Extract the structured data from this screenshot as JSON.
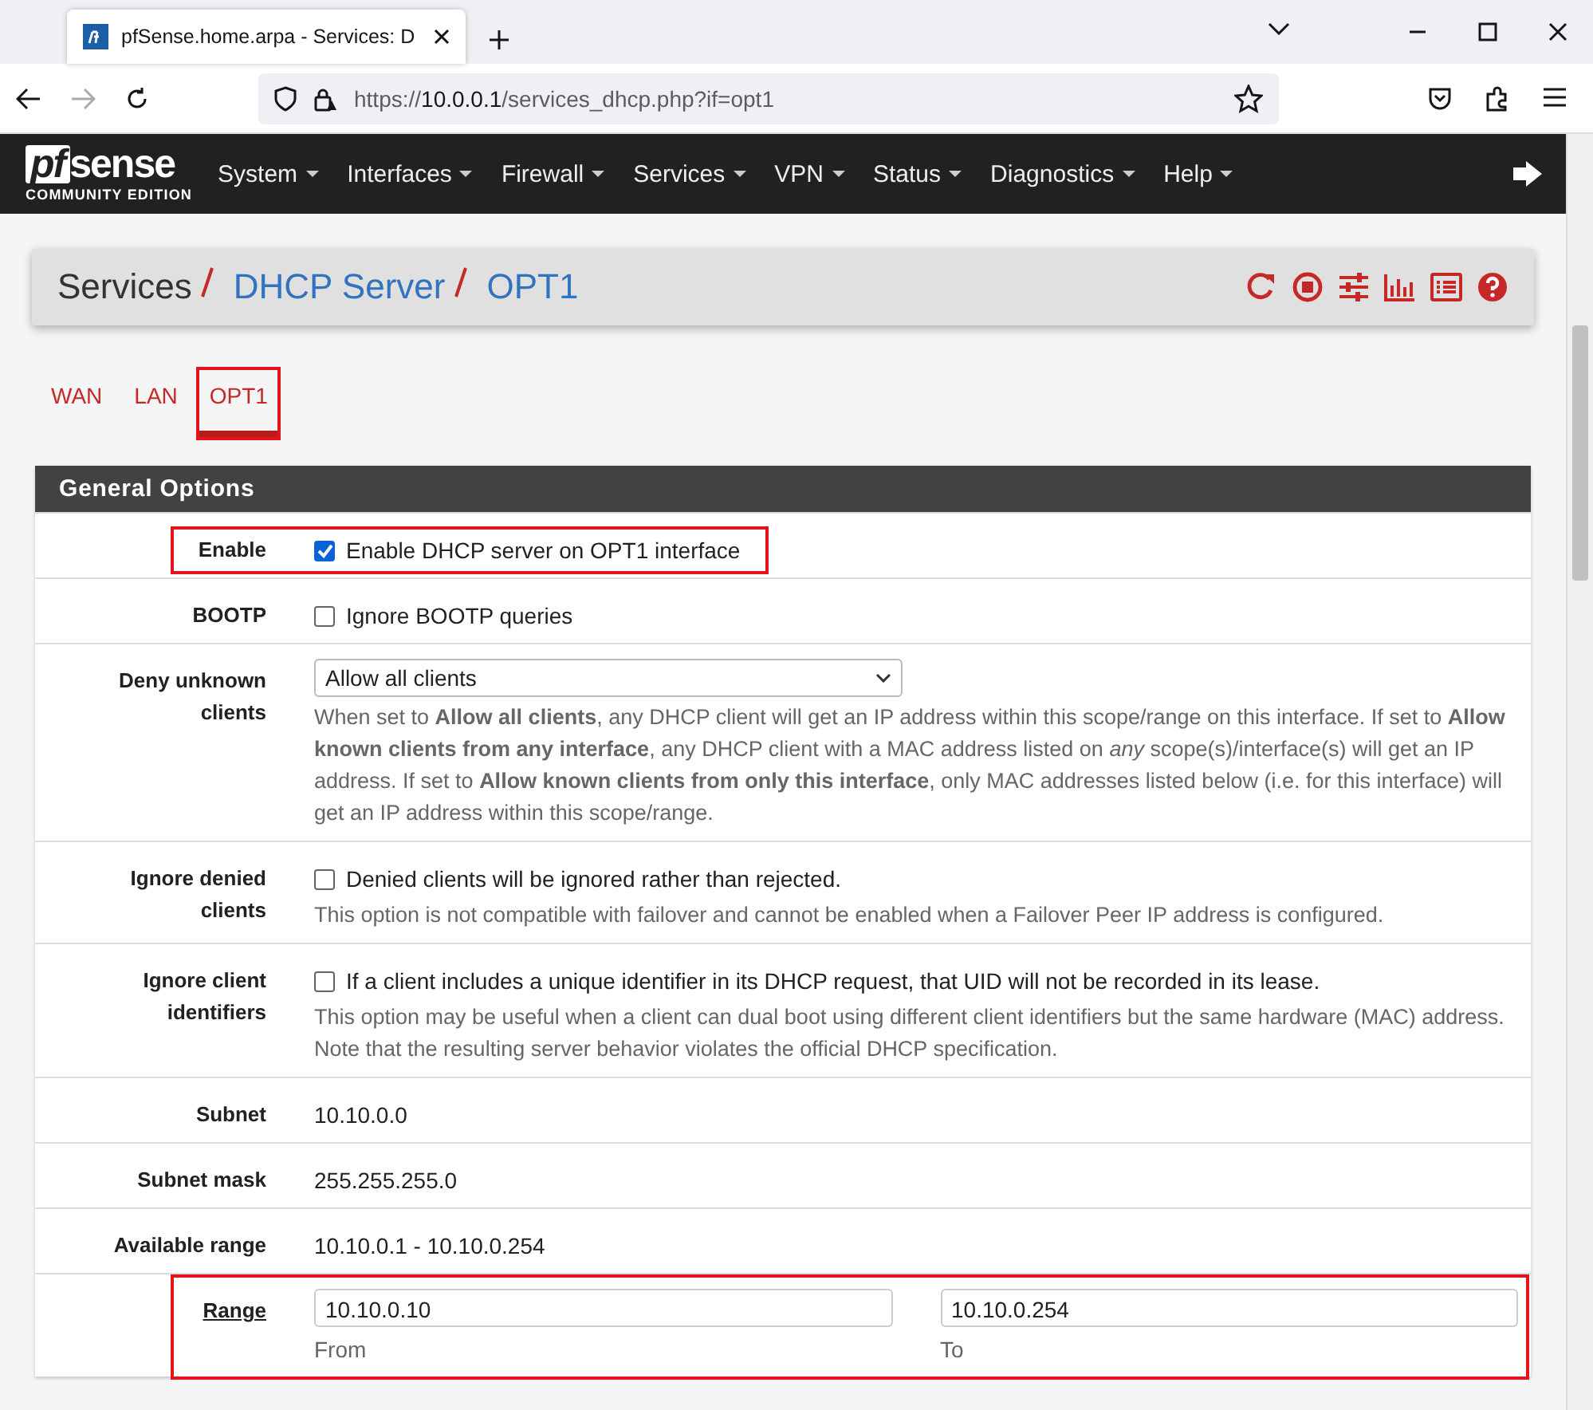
{
  "browser": {
    "tab_title": "pfSense.home.arpa - Services: D",
    "url_scheme": "https://",
    "url_host": "10.0.0.1",
    "url_path": "/services_dhcp.php?if=opt1"
  },
  "navbar": {
    "logo_pf": "pf",
    "logo_sense": "sense",
    "logo_subtitle": "COMMUNITY EDITION",
    "menus": [
      "System",
      "Interfaces",
      "Firewall",
      "Services",
      "VPN",
      "Status",
      "Diagnostics",
      "Help"
    ]
  },
  "breadcrumb": [
    {
      "text": "Services",
      "kind": "plain"
    },
    {
      "text": "DHCP Server",
      "kind": "link"
    },
    {
      "text": "OPT1",
      "kind": "link"
    }
  ],
  "tabs": [
    {
      "label": "WAN",
      "selected": false,
      "highlighted": false
    },
    {
      "label": "LAN",
      "selected": false,
      "highlighted": false
    },
    {
      "label": "OPT1",
      "selected": true,
      "highlighted": true
    }
  ],
  "section": {
    "title": "General Options",
    "rows": [
      {
        "kind": "checkbox",
        "label": "Enable",
        "text": "Enable DHCP server on OPT1 interface",
        "checked": true,
        "highlighted": true
      },
      {
        "kind": "checkbox",
        "label": "BOOTP",
        "text": "Ignore BOOTP queries",
        "checked": false,
        "highlighted": false
      },
      {
        "kind": "select",
        "label": "Deny unknown clients",
        "value": "Allow all clients",
        "help": "When set to **Allow all clients**, any DHCP client will get an IP address within this scope/range on this interface. If set to **Allow known clients from any interface**, any DHCP client with a MAC address listed on *any* scope(s)/interface(s) will get an IP address. If set to **Allow known clients from only this interface**, only MAC addresses listed below (i.e. for this interface) will get an IP address within this scope/range.",
        "highlighted": false
      },
      {
        "kind": "checkbox",
        "label": "Ignore denied clients",
        "text": "Denied clients will be ignored rather than rejected.",
        "checked": false,
        "help": "This option is not compatible with failover and cannot be enabled when a Failover Peer IP address is configured.",
        "highlighted": false
      },
      {
        "kind": "checkbox",
        "label": "Ignore client identifiers",
        "text": "If a client includes a unique identifier in its DHCP request, that UID will not be recorded in its lease.",
        "checked": false,
        "help": "This option may be useful when a client can dual boot using different client identifiers but the same hardware (MAC) address. Note that the resulting server behavior violates the official DHCP specification.",
        "highlighted": false
      },
      {
        "kind": "static",
        "label": "Subnet",
        "value": "10.10.0.0",
        "highlighted": false
      },
      {
        "kind": "static",
        "label": "Subnet mask",
        "value": "255.255.255.0",
        "highlighted": false
      },
      {
        "kind": "static",
        "label": "Available range",
        "value": "10.10.0.1 - 10.10.0.254",
        "highlighted": false
      },
      {
        "kind": "range",
        "label": "Range",
        "from_value": "10.10.0.10",
        "from_caption": "From",
        "to_value": "10.10.0.254",
        "to_caption": "To",
        "highlighted": true
      }
    ]
  }
}
